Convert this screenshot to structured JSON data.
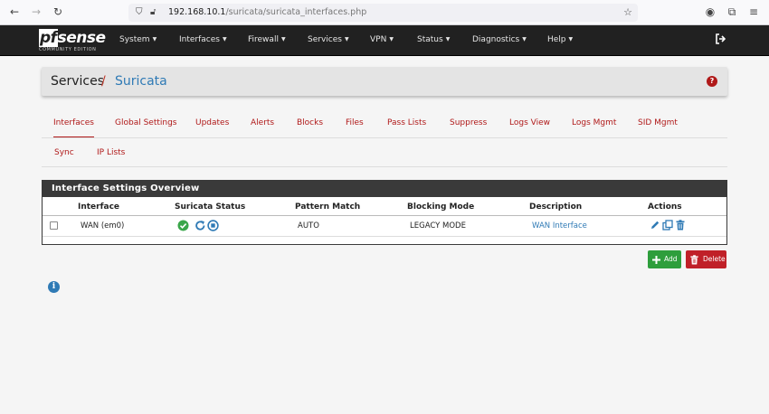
{
  "browser": {
    "url_host": "192.168.10.1",
    "url_path": "/suricata/suricata_interfaces.php"
  },
  "navbar": {
    "logo_text": "sense",
    "logo_prefix": "pf",
    "edition": "COMMUNITY EDITION",
    "items": [
      {
        "label": "System"
      },
      {
        "label": "Interfaces"
      },
      {
        "label": "Firewall"
      },
      {
        "label": "Services"
      },
      {
        "label": "VPN"
      },
      {
        "label": "Status"
      },
      {
        "label": "Diagnostics"
      },
      {
        "label": "Help"
      }
    ]
  },
  "breadcrumb": {
    "parent": "Services",
    "separator": "/",
    "current": "Suricata",
    "help": "?"
  },
  "tabs": [
    {
      "label": "Interfaces",
      "active": true
    },
    {
      "label": "Global Settings"
    },
    {
      "label": "Updates"
    },
    {
      "label": "Alerts"
    },
    {
      "label": "Blocks"
    },
    {
      "label": "Files"
    },
    {
      "label": "Pass Lists"
    },
    {
      "label": "Suppress"
    },
    {
      "label": "Logs View"
    },
    {
      "label": "Logs Mgmt"
    },
    {
      "label": "SID Mgmt"
    },
    {
      "label": "Sync"
    },
    {
      "label": "IP Lists"
    }
  ],
  "panel": {
    "title": "Interface Settings Overview",
    "columns": [
      "Interface",
      "Suricata Status",
      "Pattern Match",
      "Blocking Mode",
      "Description",
      "Actions"
    ],
    "rows": [
      {
        "interface": "WAN (em0)",
        "status": "running",
        "pattern_match": "AUTO",
        "blocking_mode": "LEGACY MODE",
        "description": "WAN Interface"
      }
    ]
  },
  "buttons": {
    "add": "Add",
    "delete": "Delete"
  },
  "info_icon": "i",
  "colors": {
    "brand_red": "#b01919",
    "link_blue": "#2f7ab5",
    "add_green": "#2e9e3c",
    "navbar": "#212121",
    "status_ok": "#3aa64a"
  }
}
